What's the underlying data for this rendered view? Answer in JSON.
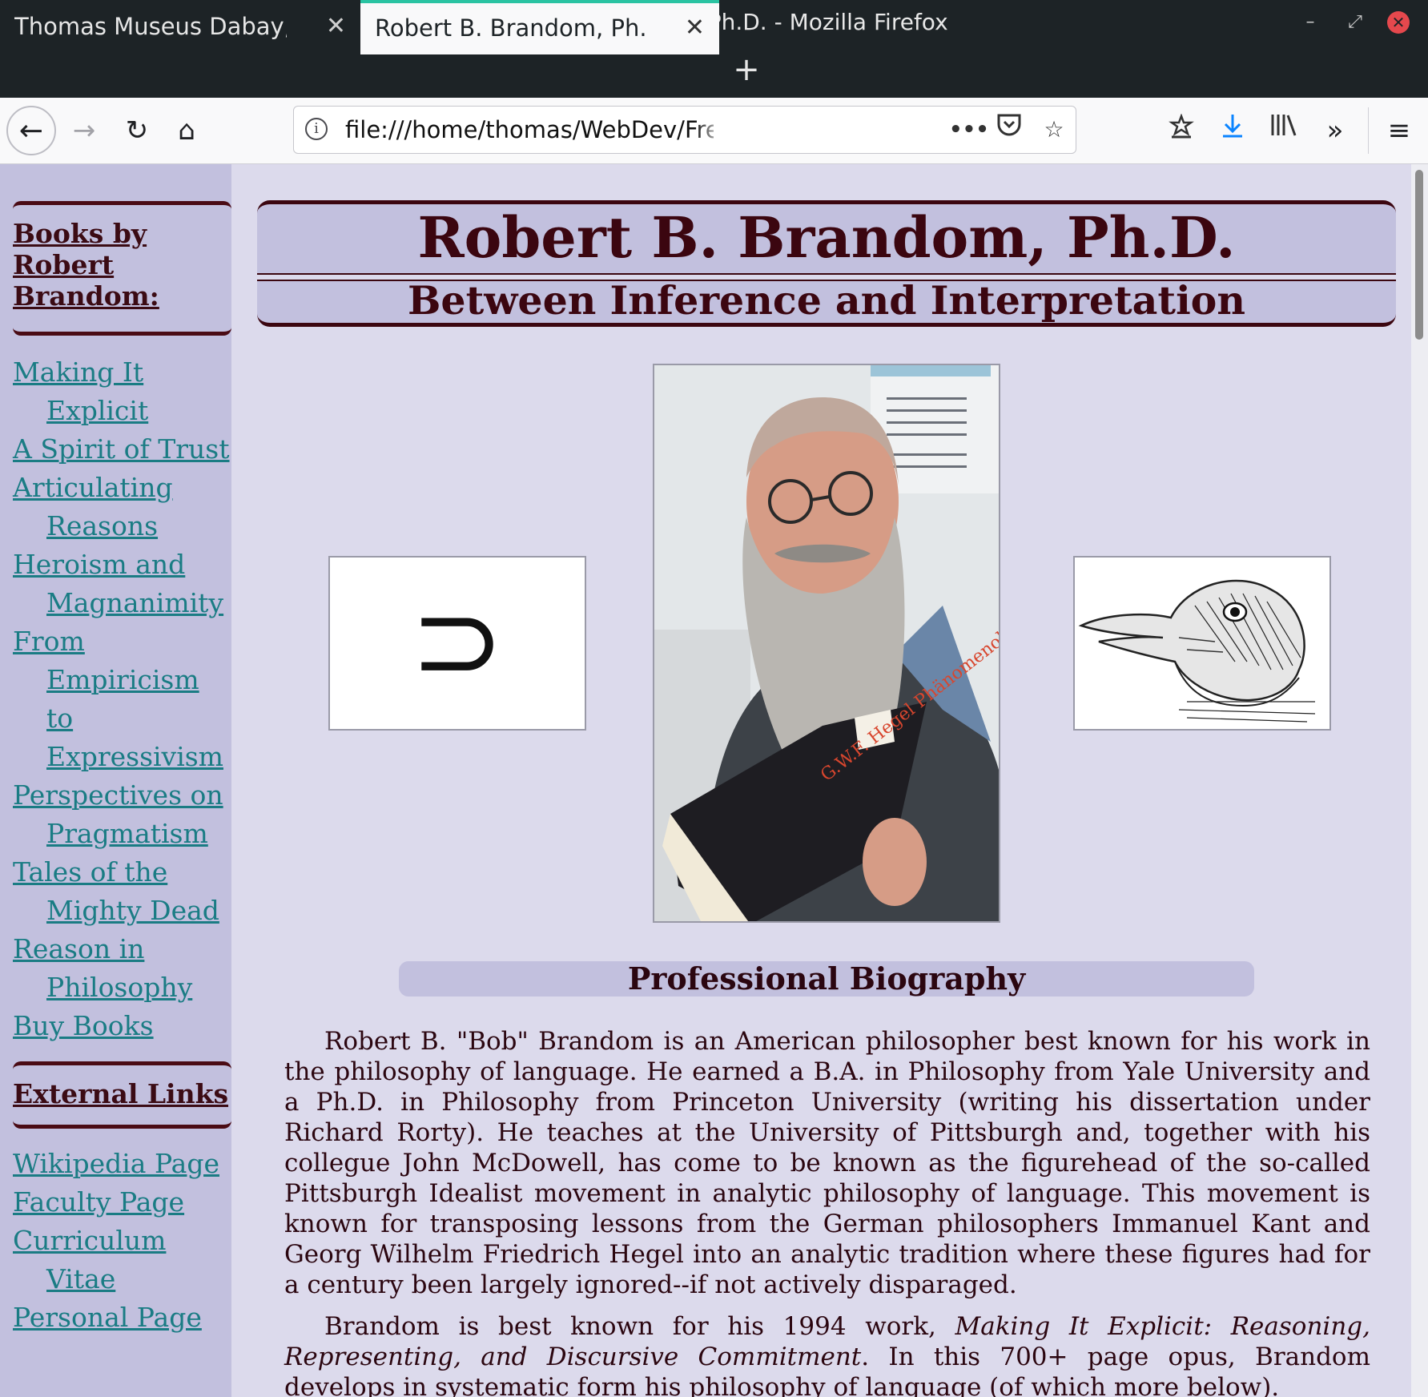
{
  "window": {
    "title": "Robert B. Brandom, Ph.D. - Mozilla Firefox"
  },
  "tabs": [
    {
      "label": "Thomas Museus Dabay, Ph.D."
    },
    {
      "label": "Robert B. Brandom, Ph.D."
    }
  ],
  "navbar": {
    "url": "file:///home/thomas/WebDev/FreeCodeCamp/Trib",
    "more": "•••"
  },
  "sidebar": {
    "books_heading": "Books by Robert Brandom:",
    "books": [
      "Making It Explicit",
      "A Spirit of Trust",
      "Articulating Reasons",
      "Heroism and Magnanimity",
      "From Empiricism to Expressivism",
      "Perspectives on Pragmatism",
      "Tales of the Mighty Dead",
      "Reason in Philosophy",
      "Buy Books"
    ],
    "links_heading": "External Links",
    "links": [
      "Wikipedia Page",
      "Faculty Page",
      "Curriculum Vitae",
      "Personal Page"
    ]
  },
  "header": {
    "title": "Robert B. Brandom, Ph.D.",
    "subtitle": "Between Inference and Interpretation"
  },
  "figures": {
    "left_symbol": "⊃",
    "photo_book_title": "G.W.F. Hegel Phänomenologie des Geistes"
  },
  "bio": {
    "heading": "Professional Biography",
    "p1": "Robert B. \"Bob\" Brandom is an American philosopher best known for his work in the philosophy of language. He earned a B.A. in Philosophy from Yale University and a Ph.D. in Philosophy from Princeton University (writing his dissertation under Richard Rorty). He teaches at the University of Pittsburgh and, together with his collegue John McDowell, has come to be known as the figurehead of the so-called Pittsburgh Idealist movement in analytic philosophy of language. This movement is known for transposing lessons from the German philosophers Immanuel Kant and Georg Wilhelm Friedrich Hegel into an analytic tradition where these figures had for a century been largely ignored--if not actively disparaged.",
    "p2_start": "Brandom is best known for his 1994 work, ",
    "p2_book": "Making It Explicit: Reasoning, Representing, and Discursive Commitment",
    "p2_rest": ". In this 700+ page opus, Brandom develops in systematic form his philosophy of language (of which more below)."
  }
}
